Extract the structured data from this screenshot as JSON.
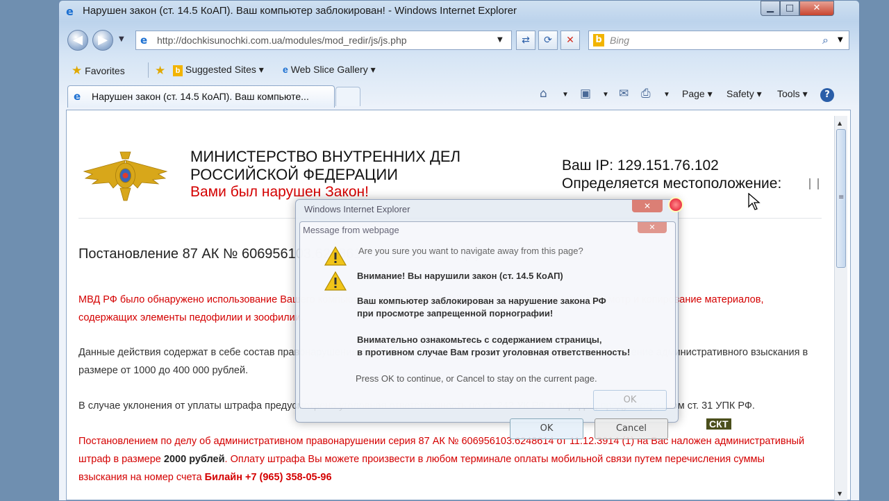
{
  "window": {
    "title": "Нарушен закон (ст. 14.5 КоАП). Ваш компьютер заблокирован! - Windows Internet Explorer",
    "minimize": "▁",
    "maximize": "□",
    "close": "✕"
  },
  "nav": {
    "back": "◀",
    "forward": "▶",
    "dropdown": "▼",
    "address_url": "http://dochkisunochki.com.ua/modules/mod_redir/js/js.php",
    "compat": "⇄",
    "refresh": "⟳",
    "stop": "✕",
    "search_placeholder": "Bing",
    "search_glyph": "⌕"
  },
  "favorites_bar": {
    "favorites_label": "Favorites",
    "suggested_sites": "Suggested Sites ▾",
    "web_slice": "Web Slice Gallery ▾"
  },
  "tab": {
    "label": "Нарушен закон (ст. 14.5 КоАП). Ваш компьюте..."
  },
  "command_bar": {
    "page": "Page ▾",
    "safety": "Safety ▾",
    "tools": "Tools ▾",
    "help": "?"
  },
  "page": {
    "ministry_line1": "МИНИСТЕРСТВО ВНУТРЕННИХ ДЕЛ",
    "ministry_line2": "РОССИЙСКОЙ ФЕДЕРАЦИИ",
    "law_broken": "Вами был нарушен Закон!",
    "ip_line": "Ваш IP: 129.151.76.102",
    "location_line": "Определяется местоположение:",
    "decree": "Постановление 87 АК № 606956103.6248614 от 11.12.3914 (1)",
    "p1": "МВД РФ было обнаружено использование Вашего компьютера в противоправной деятельности, а именно - просмотр и копирование материалов, содержащих элементы педофилии и зоофилии.",
    "p2": "Данные действия содержат в себе состав правонарушения, предусмотренного ст. 14.5 КоАП и влекут за собой наложение административного взыскания в размере от 1000 до 400 000 рублей.",
    "p3": "В случае уклонения от уплаты штрафа предусмотрена уголовная ответственность по ст. 242 УК РФ в порядке, предусмотренном ст. 31 УПК РФ.",
    "p4_a": "Постановлением по делу об административном правонарушении серия 87 АК № 606956103.6248614 от 11.12.3914 (1) на Вас наложен административный штраф в размере ",
    "p4_amount": "2000 рублей",
    "p4_b": ". Оплату штрафа Вы можете произвести в любом терминале оплаты мобильной связи путем перечисления суммы взыскания на номер счета ",
    "p4_account": "Билайн +7 (965) 358-05-96",
    "skt_badge": "СКТ"
  },
  "dialog_back": {
    "title": "Windows Internet Explorer",
    "close": "✕",
    "ok": "OK",
    "cancel": "Cancel"
  },
  "dialog": {
    "title": "Message from webpage",
    "close": "✕",
    "question": "Are you sure you want to navigate away from this page?",
    "line1": "Внимание! Вы нарушили закон (ст. 14.5 КоАП)",
    "line2": "Ваш компьютер заблокирован за нарушение закона РФ",
    "line3": "при просмотре запрещенной порнографии!",
    "line4": "Внимательно ознакомьтесь с содержанием страницы,",
    "line5": "в противном случае Вам грозит уголовная ответственность!",
    "press": "Press OK to continue, or Cancel to stay on the current page.",
    "ok_ghost": "OK"
  },
  "colors": {
    "alert_red": "#d40000",
    "ie_blue": "#1b6fd1",
    "bing_yellow": "#f2b400"
  },
  "icons": [
    "ie-logo-icon",
    "back-icon",
    "forward-icon",
    "compat-view-icon",
    "refresh-icon",
    "stop-icon",
    "bing-icon",
    "search-icon",
    "favorites-star-icon",
    "add-favorites-icon",
    "home-icon",
    "rss-icon",
    "mail-icon",
    "print-icon",
    "help-icon",
    "warning-icon",
    "police-emblem-icon",
    "mouse-cursor-icon"
  ]
}
